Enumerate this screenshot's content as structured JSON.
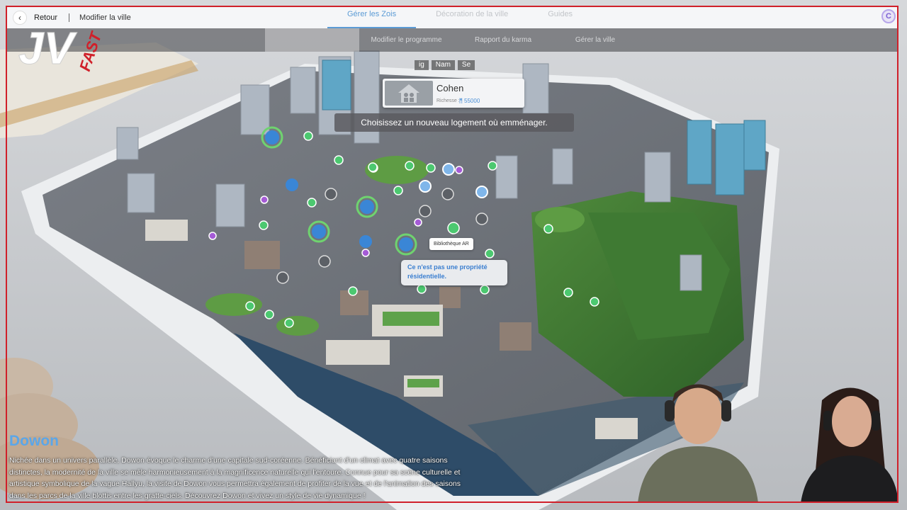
{
  "topbar": {
    "back_label": "Retour",
    "modify_label": "Modifier la ville",
    "tabs": [
      {
        "label": "Gérer les Zois",
        "active": true
      },
      {
        "label": "Décoration de la ville",
        "active": false
      },
      {
        "label": "Guides",
        "active": false
      }
    ],
    "avatar_letter": "C"
  },
  "subtabs": [
    {
      "label": "",
      "active": true
    },
    {
      "label": "Modifier le programme",
      "active": false
    },
    {
      "label": "Rapport du karma",
      "active": false
    },
    {
      "label": "Gérer la ville",
      "active": false
    }
  ],
  "logo": {
    "main": "JV",
    "sub": "FAST"
  },
  "filters": [
    "ig",
    "Nam",
    "Se"
  ],
  "household": {
    "name": "Cohen",
    "wealth_label": "Richesse :",
    "currency_icon": "meow-currency-icon",
    "wealth_value": "55000"
  },
  "prompt": "Choisissez un nouveau logement où emménager.",
  "map_labels": {
    "poi_name": "Bibliothèque AR",
    "poi_message": "Ce n'est pas une propriété résidentielle."
  },
  "city": {
    "name": "Dowon",
    "description": "Nichée dans un univers parallèle, Dowon évoque le charme d'une capitale sud-coréenne. Bénéficiant d'un climat avec quatre saisons distinctes, la modernité de la ville se mêle harmonieusement à la magnificence naturelle qui l'entoure. Connue pour sa scène culturelle et artistique symbolique de la vague Hallyu, la visite de Dowon vous permettra également de profiter de la vue et de l'animation des saisons dans les parcs de la ville blottis entre les gratte-ciels. Découvrez Dowon et vivez un style de vie dynamique !"
  },
  "colors": {
    "accent_blue": "#5ba6e8",
    "pin_green": "#4cc870",
    "pin_purple": "#a55bd6",
    "pin_blue": "#3a86d6",
    "pin_gray": "#6c7075",
    "frame_red": "#d0202a"
  }
}
